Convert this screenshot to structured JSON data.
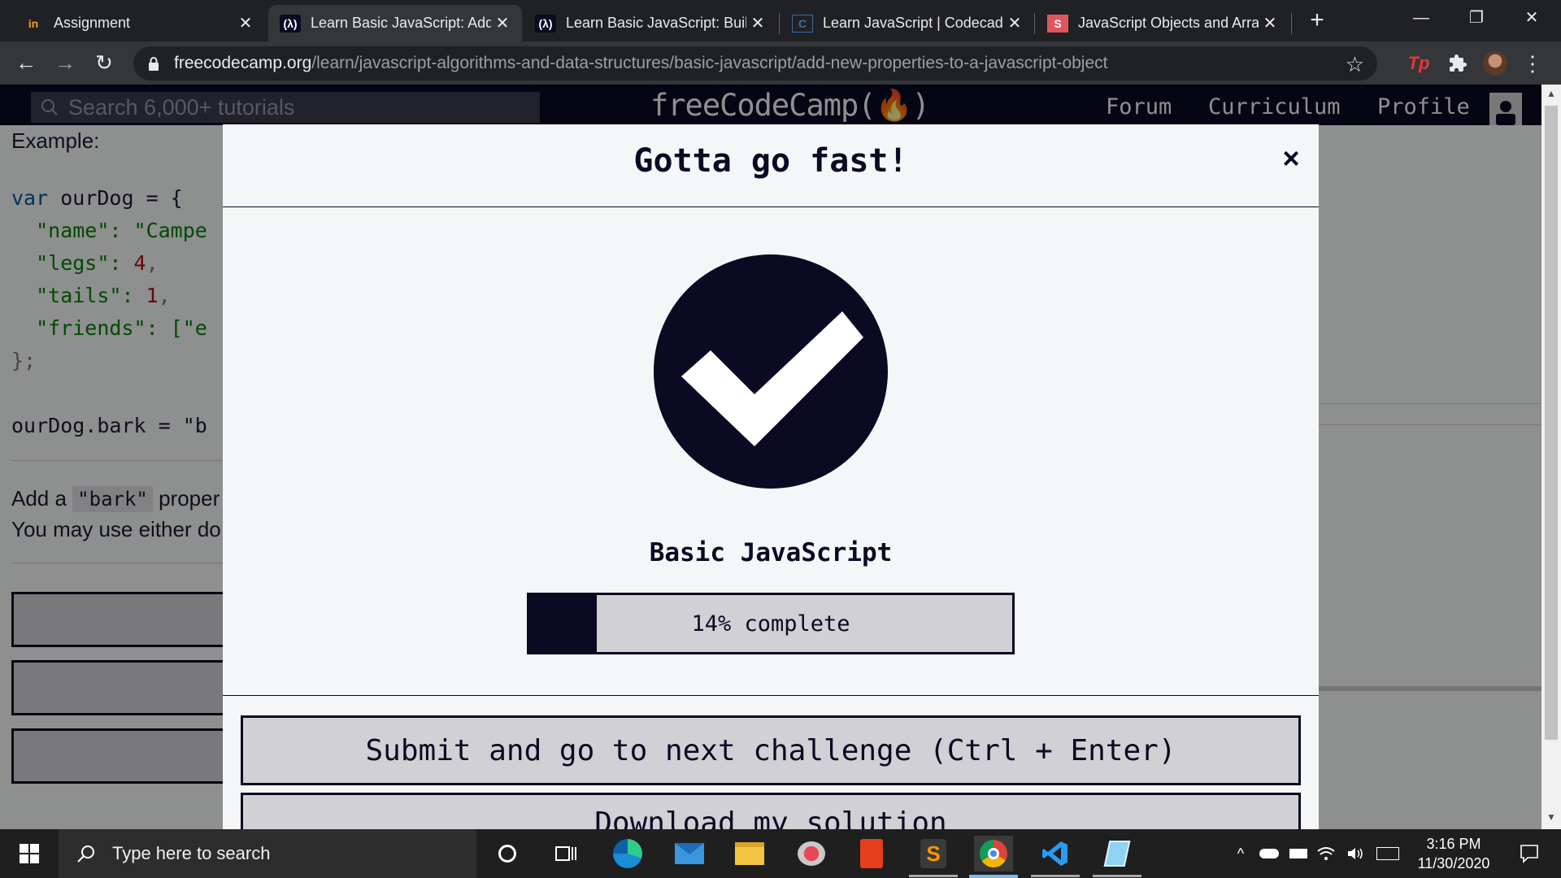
{
  "browser": {
    "tabs": [
      {
        "title": "Assignment",
        "favicon": "in"
      },
      {
        "title": "Learn Basic JavaScript: Add",
        "favicon": "(λ)"
      },
      {
        "title": "Learn Basic JavaScript: Build",
        "favicon": "(λ)"
      },
      {
        "title": "Learn JavaScript | Codecademy",
        "favicon": "C"
      },
      {
        "title": "JavaScript Objects and Arrays",
        "favicon": "S"
      }
    ],
    "active_tab_index": 1,
    "url_host": "freecodecamp.org",
    "url_path": "/learn/javascript-algorithms-and-data-structures/basic-javascript/add-new-properties-to-a-javascript-object",
    "extension_label": "Tp"
  },
  "fcc_nav": {
    "search_placeholder": "Search 6,000+ tutorials",
    "logo": "freeCodeCamp(🔥)",
    "links": [
      "Forum",
      "Curriculum",
      "Profile"
    ]
  },
  "lesson": {
    "example_label": "Example:",
    "code_lines": [
      {
        "kw": "var ",
        "rest": "ourDog = {"
      },
      {
        "str": "  \"name\": ",
        "tail": "\"Campe"
      },
      {
        "str": "  \"legs\": ",
        "num": "4",
        "tail": ","
      },
      {
        "str": "  \"tails\": ",
        "num": "1",
        "tail": ","
      },
      {
        "str": "  \"friends\": ",
        "tail": "[\"e"
      },
      {
        "pun": "};"
      },
      {
        "rest": ""
      },
      {
        "rest": "ourDog.bark = \"b"
      }
    ],
    "instruction_prefix": "Add a ",
    "instruction_code": "\"bark\"",
    "instruction_suffix": " proper",
    "instruction_line2": "You may use either do"
  },
  "modal": {
    "title": "Gotta go fast!",
    "close_label": "×",
    "block_title": "Basic JavaScript",
    "progress_percent": 14,
    "progress_label": "14% complete",
    "submit_label": "Submit and go to next challenge (Ctrl + Enter)",
    "download_label": "Download my solution"
  },
  "taskbar": {
    "search_placeholder": "Type here to search",
    "time": "3:16 PM",
    "date": "11/30/2020"
  },
  "colors": {
    "fcc_dark": "#0a0a23",
    "fcc_gray": "#d0d0d5",
    "fcc_bg": "#f5f6f7"
  }
}
